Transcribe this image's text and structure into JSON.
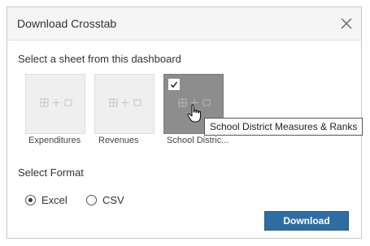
{
  "dialog": {
    "title": "Download Crosstab",
    "close_icon": "close-icon"
  },
  "sheets": {
    "label": "Select a sheet from this dashboard",
    "items": [
      {
        "label": "Expenditures",
        "selected": false
      },
      {
        "label": "Revenues",
        "selected": false
      },
      {
        "label": "School Distric...",
        "selected": true
      }
    ],
    "tooltip": "School District Measures & Ranks",
    "check_icon": "checkmark-icon"
  },
  "format": {
    "label": "Select Format",
    "options": [
      {
        "label": "Excel",
        "selected": true
      },
      {
        "label": "CSV",
        "selected": false
      }
    ]
  },
  "actions": {
    "download_label": "Download"
  },
  "colors": {
    "primary_button": "#2e6da4",
    "selected_thumb": "#8d8d8d",
    "thumb_bg": "#efefef"
  }
}
